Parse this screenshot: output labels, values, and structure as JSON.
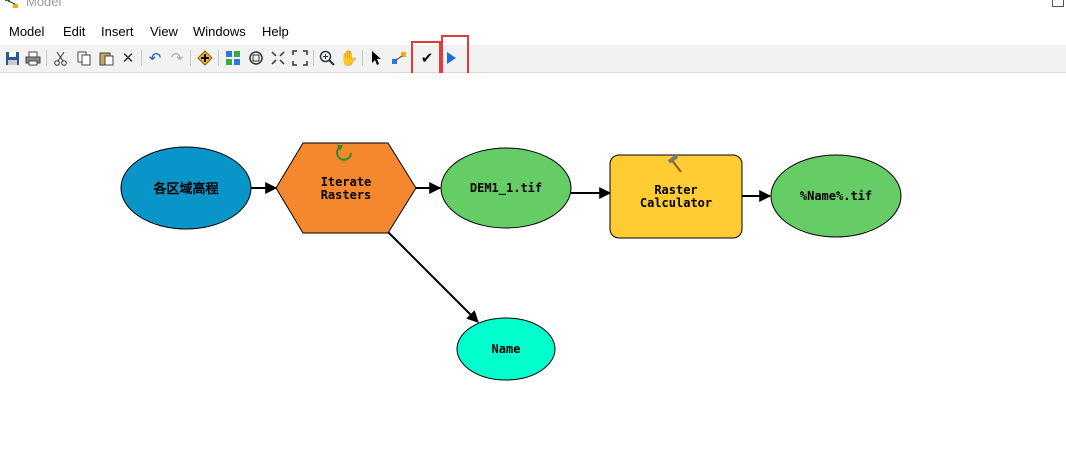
{
  "window": {
    "title": "Model"
  },
  "menu": [
    "Model",
    "Edit",
    "Insert",
    "View",
    "Windows",
    "Help"
  ],
  "toolbar": {
    "icons": [
      "save-icon",
      "print-icon",
      "cut-icon",
      "copy-icon",
      "paste-icon",
      "delete-icon",
      "undo-icon",
      "redo-icon",
      "add-data-icon",
      "auto-layout-icon",
      "full-extent-icon",
      "fixed-zoom-in-icon",
      "fixed-zoom-out-icon",
      "zoom-in-icon",
      "pan-icon",
      "select-icon",
      "connect-icon",
      "validate-icon",
      "run-icon"
    ],
    "highlighted": [
      "validate-icon",
      "run-icon"
    ]
  },
  "model": {
    "nodes": {
      "input": "各区域高程",
      "iterator_line1": "Iterate",
      "iterator_line2": "Rasters",
      "raster_var": "DEM1_1.tif",
      "tool_line1": "Raster",
      "tool_line2": "Calculator",
      "output": "%Name%.tif",
      "name_var": "Name"
    },
    "colors": {
      "input": "#0a95c9",
      "iterator": "#f5882e",
      "raster_var": "#66cc66",
      "tool": "#ffcc33",
      "output": "#66cc66",
      "name_var": "#00ffcc",
      "highlight": "#e23b3b"
    }
  }
}
